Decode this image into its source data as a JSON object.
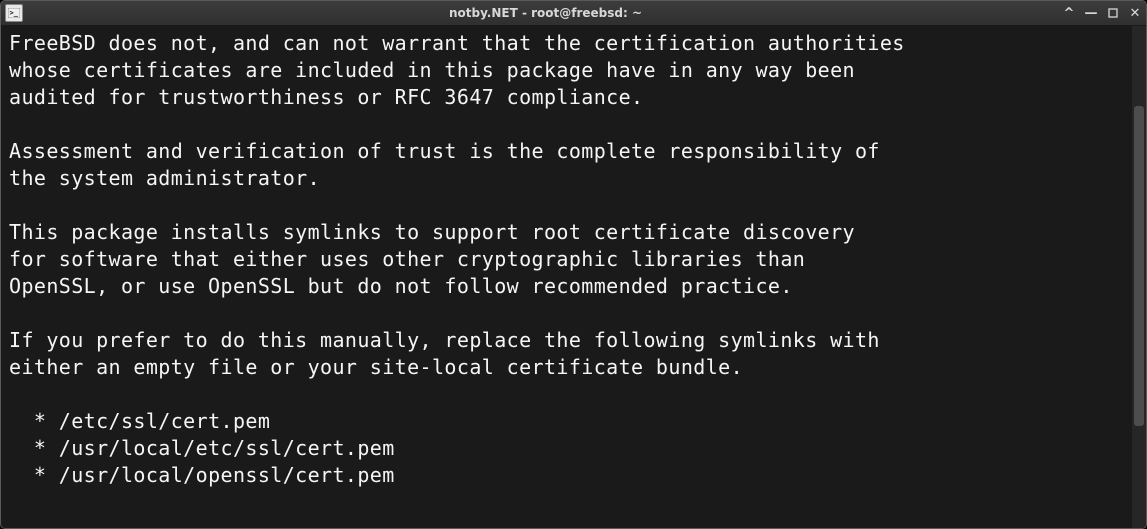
{
  "window": {
    "title": "notby.NET - root@freebsd: ~"
  },
  "terminal": {
    "lines": [
      "FreeBSD does not, and can not warrant that the certification authorities",
      "whose certificates are included in this package have in any way been",
      "audited for trustworthiness or RFC 3647 compliance.",
      "",
      "Assessment and verification of trust is the complete responsibility of",
      "the system administrator.",
      "",
      "This package installs symlinks to support root certificate discovery",
      "for software that either uses other cryptographic libraries than",
      "OpenSSL, or use OpenSSL but do not follow recommended practice.",
      "",
      "If you prefer to do this manually, replace the following symlinks with",
      "either an empty file or your site-local certificate bundle.",
      "",
      "  * /etc/ssl/cert.pem",
      "  * /usr/local/etc/ssl/cert.pem",
      "  * /usr/local/openssl/cert.pem"
    ]
  },
  "icons": {
    "rollup": "^",
    "minimize": "—",
    "close": "✕"
  }
}
